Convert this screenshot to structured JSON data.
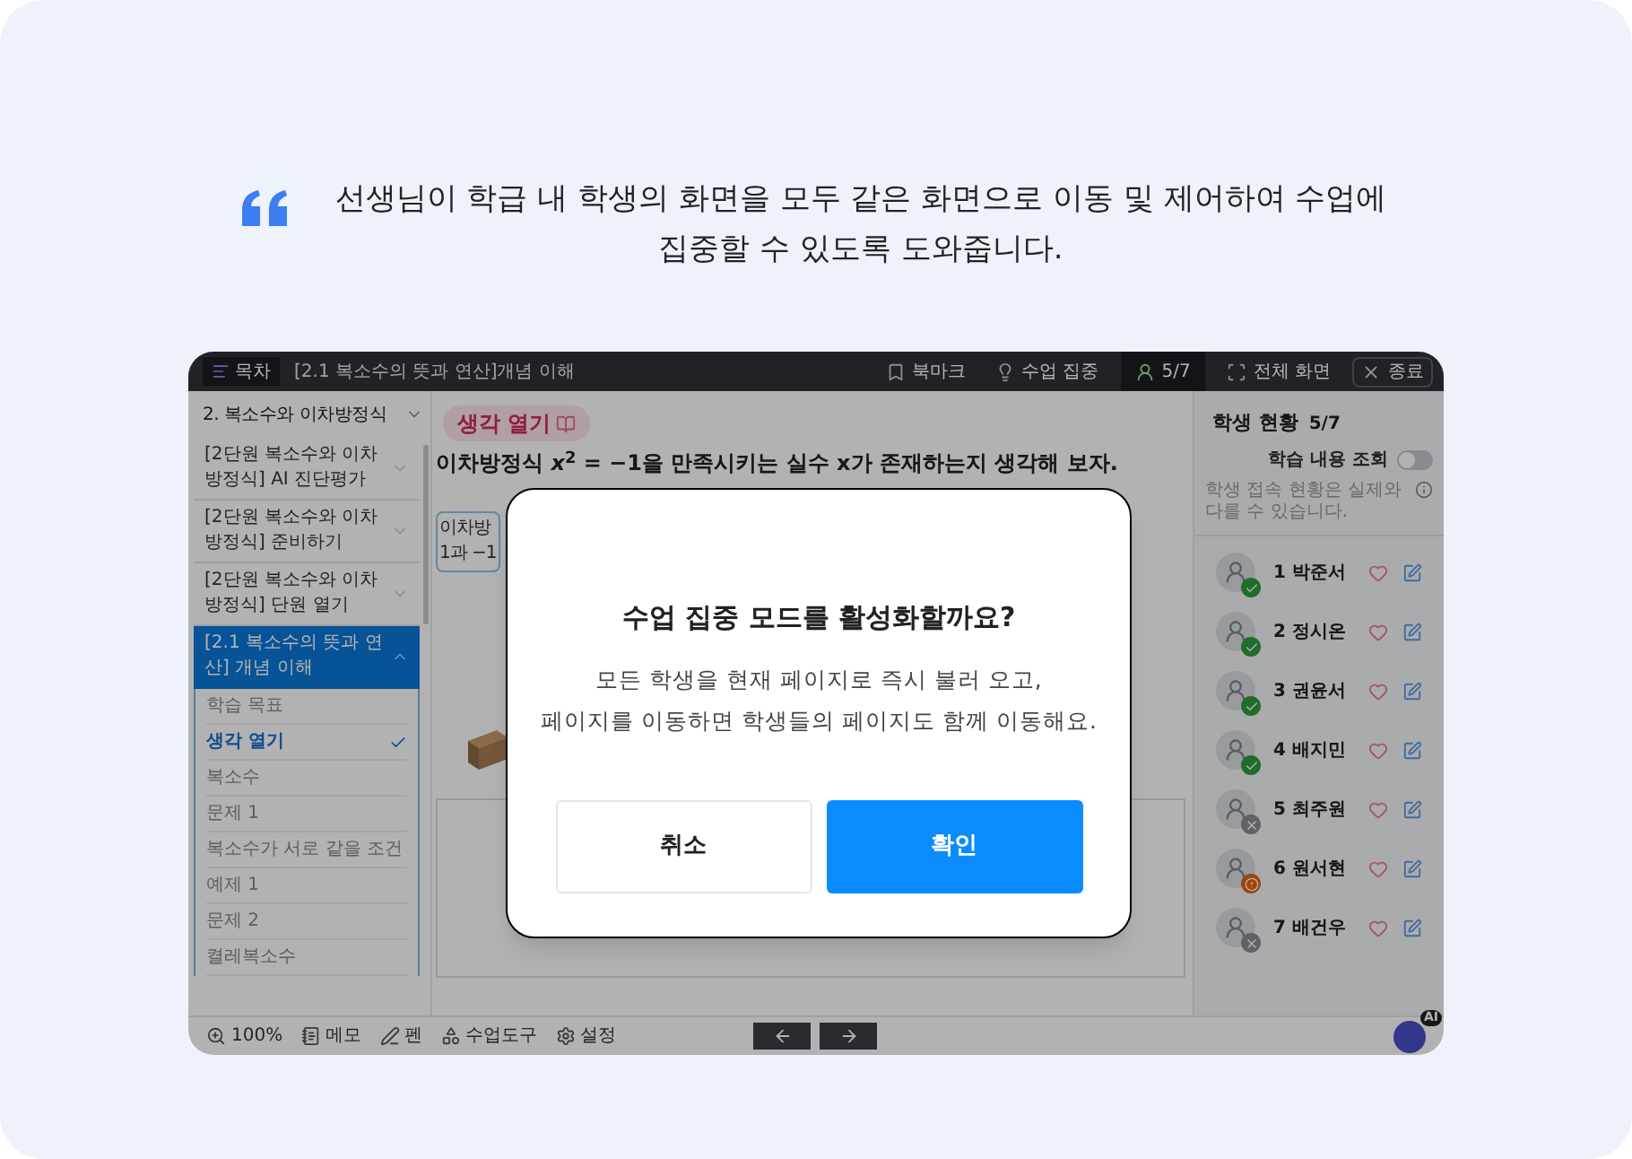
{
  "intro": {
    "lines": [
      "선생님이 학급 내 학생의 화면을 모두 같은 화면으로 이동 및 제어하여 수업에",
      "집중할 수 있도록 도와줍니다."
    ]
  },
  "app": {
    "toc_button": "목차",
    "lesson_title": "[2.1 복소수의 뜻과 연산]개념 이해",
    "toolbar": [
      {
        "kind": "bookmark",
        "label": "북마크"
      },
      {
        "kind": "focus",
        "label": "수업 집중"
      },
      {
        "kind": "students",
        "label": "5/7"
      },
      {
        "kind": "fullscreen",
        "label": "전체 화면"
      },
      {
        "kind": "exit",
        "label": "종료"
      }
    ],
    "sidebar": {
      "chapter": "2. 복소수와 이차방정식",
      "items": [
        {
          "label": "[2단원 복소수와 이차방정식] AI 진단평가",
          "selected": false,
          "expanded": false
        },
        {
          "label": "[2단원 복소수와 이차방정식] 준비하기",
          "selected": false,
          "expanded": false
        },
        {
          "label": "[2단원 복소수와 이차방정식] 단원 열기",
          "selected": false,
          "expanded": false
        },
        {
          "label": "[2.1 복소수의 뜻과 연산] 개념 이해",
          "selected": true,
          "expanded": true
        }
      ],
      "sub_items": [
        {
          "label": "학습 목표",
          "selected": false
        },
        {
          "label": "생각 열기",
          "selected": true
        },
        {
          "label": "복소수",
          "selected": false
        },
        {
          "label": "문제 1",
          "selected": false
        },
        {
          "label": "복소수가 서로 같을 조건",
          "selected": false
        },
        {
          "label": "예제 1",
          "selected": false
        },
        {
          "label": "문제 2",
          "selected": false
        },
        {
          "label": "켤레복소수",
          "selected": false
        }
      ]
    },
    "content": {
      "tag": "생각 열기",
      "question": "이차방정식 *x*$^{2}$ = −1을 만족시키는 실수 x가 존재하는지 생각해 보자.",
      "card_lines": [
        "이차방",
        "1과 −1"
      ]
    },
    "students_panel": {
      "title": "학생 현황",
      "count": "5/7",
      "toggle_label": "학습 내용 조회",
      "toggle_on": false,
      "note": "학생 접속 현황은 실제와 다를 수 있습니다.",
      "students": [
        {
          "name": "1 박준서",
          "kind": "online"
        },
        {
          "name": "2 정시온",
          "kind": "online"
        },
        {
          "name": "3 권윤서",
          "kind": "online"
        },
        {
          "name": "4 배지민",
          "kind": "online"
        },
        {
          "name": "5 최주원",
          "kind": "offline"
        },
        {
          "name": "6 원서현",
          "kind": "warning"
        },
        {
          "name": "7 배건우",
          "kind": "offline"
        }
      ]
    },
    "bottom_bar": {
      "tools": [
        {
          "kind": "zoom",
          "label": "100%"
        },
        {
          "kind": "memo",
          "label": "메모"
        },
        {
          "kind": "pen",
          "label": "펜"
        },
        {
          "kind": "tools",
          "label": "수업도구"
        },
        {
          "kind": "settings",
          "label": "설정"
        }
      ],
      "assistant_badge": "AI"
    }
  },
  "dialog": {
    "title": "수업 집중 모드를 활성화할까요?",
    "message_lines": [
      "모든 학생을 현재 페이지로 즉시 불러 오고,",
      "페이지를 이동하면 학생들의 페이지도 함께 이동해요."
    ],
    "buttons": [
      {
        "kind": "secondary",
        "label": "취소"
      },
      {
        "kind": "primary",
        "label": "확인"
      }
    ]
  }
}
